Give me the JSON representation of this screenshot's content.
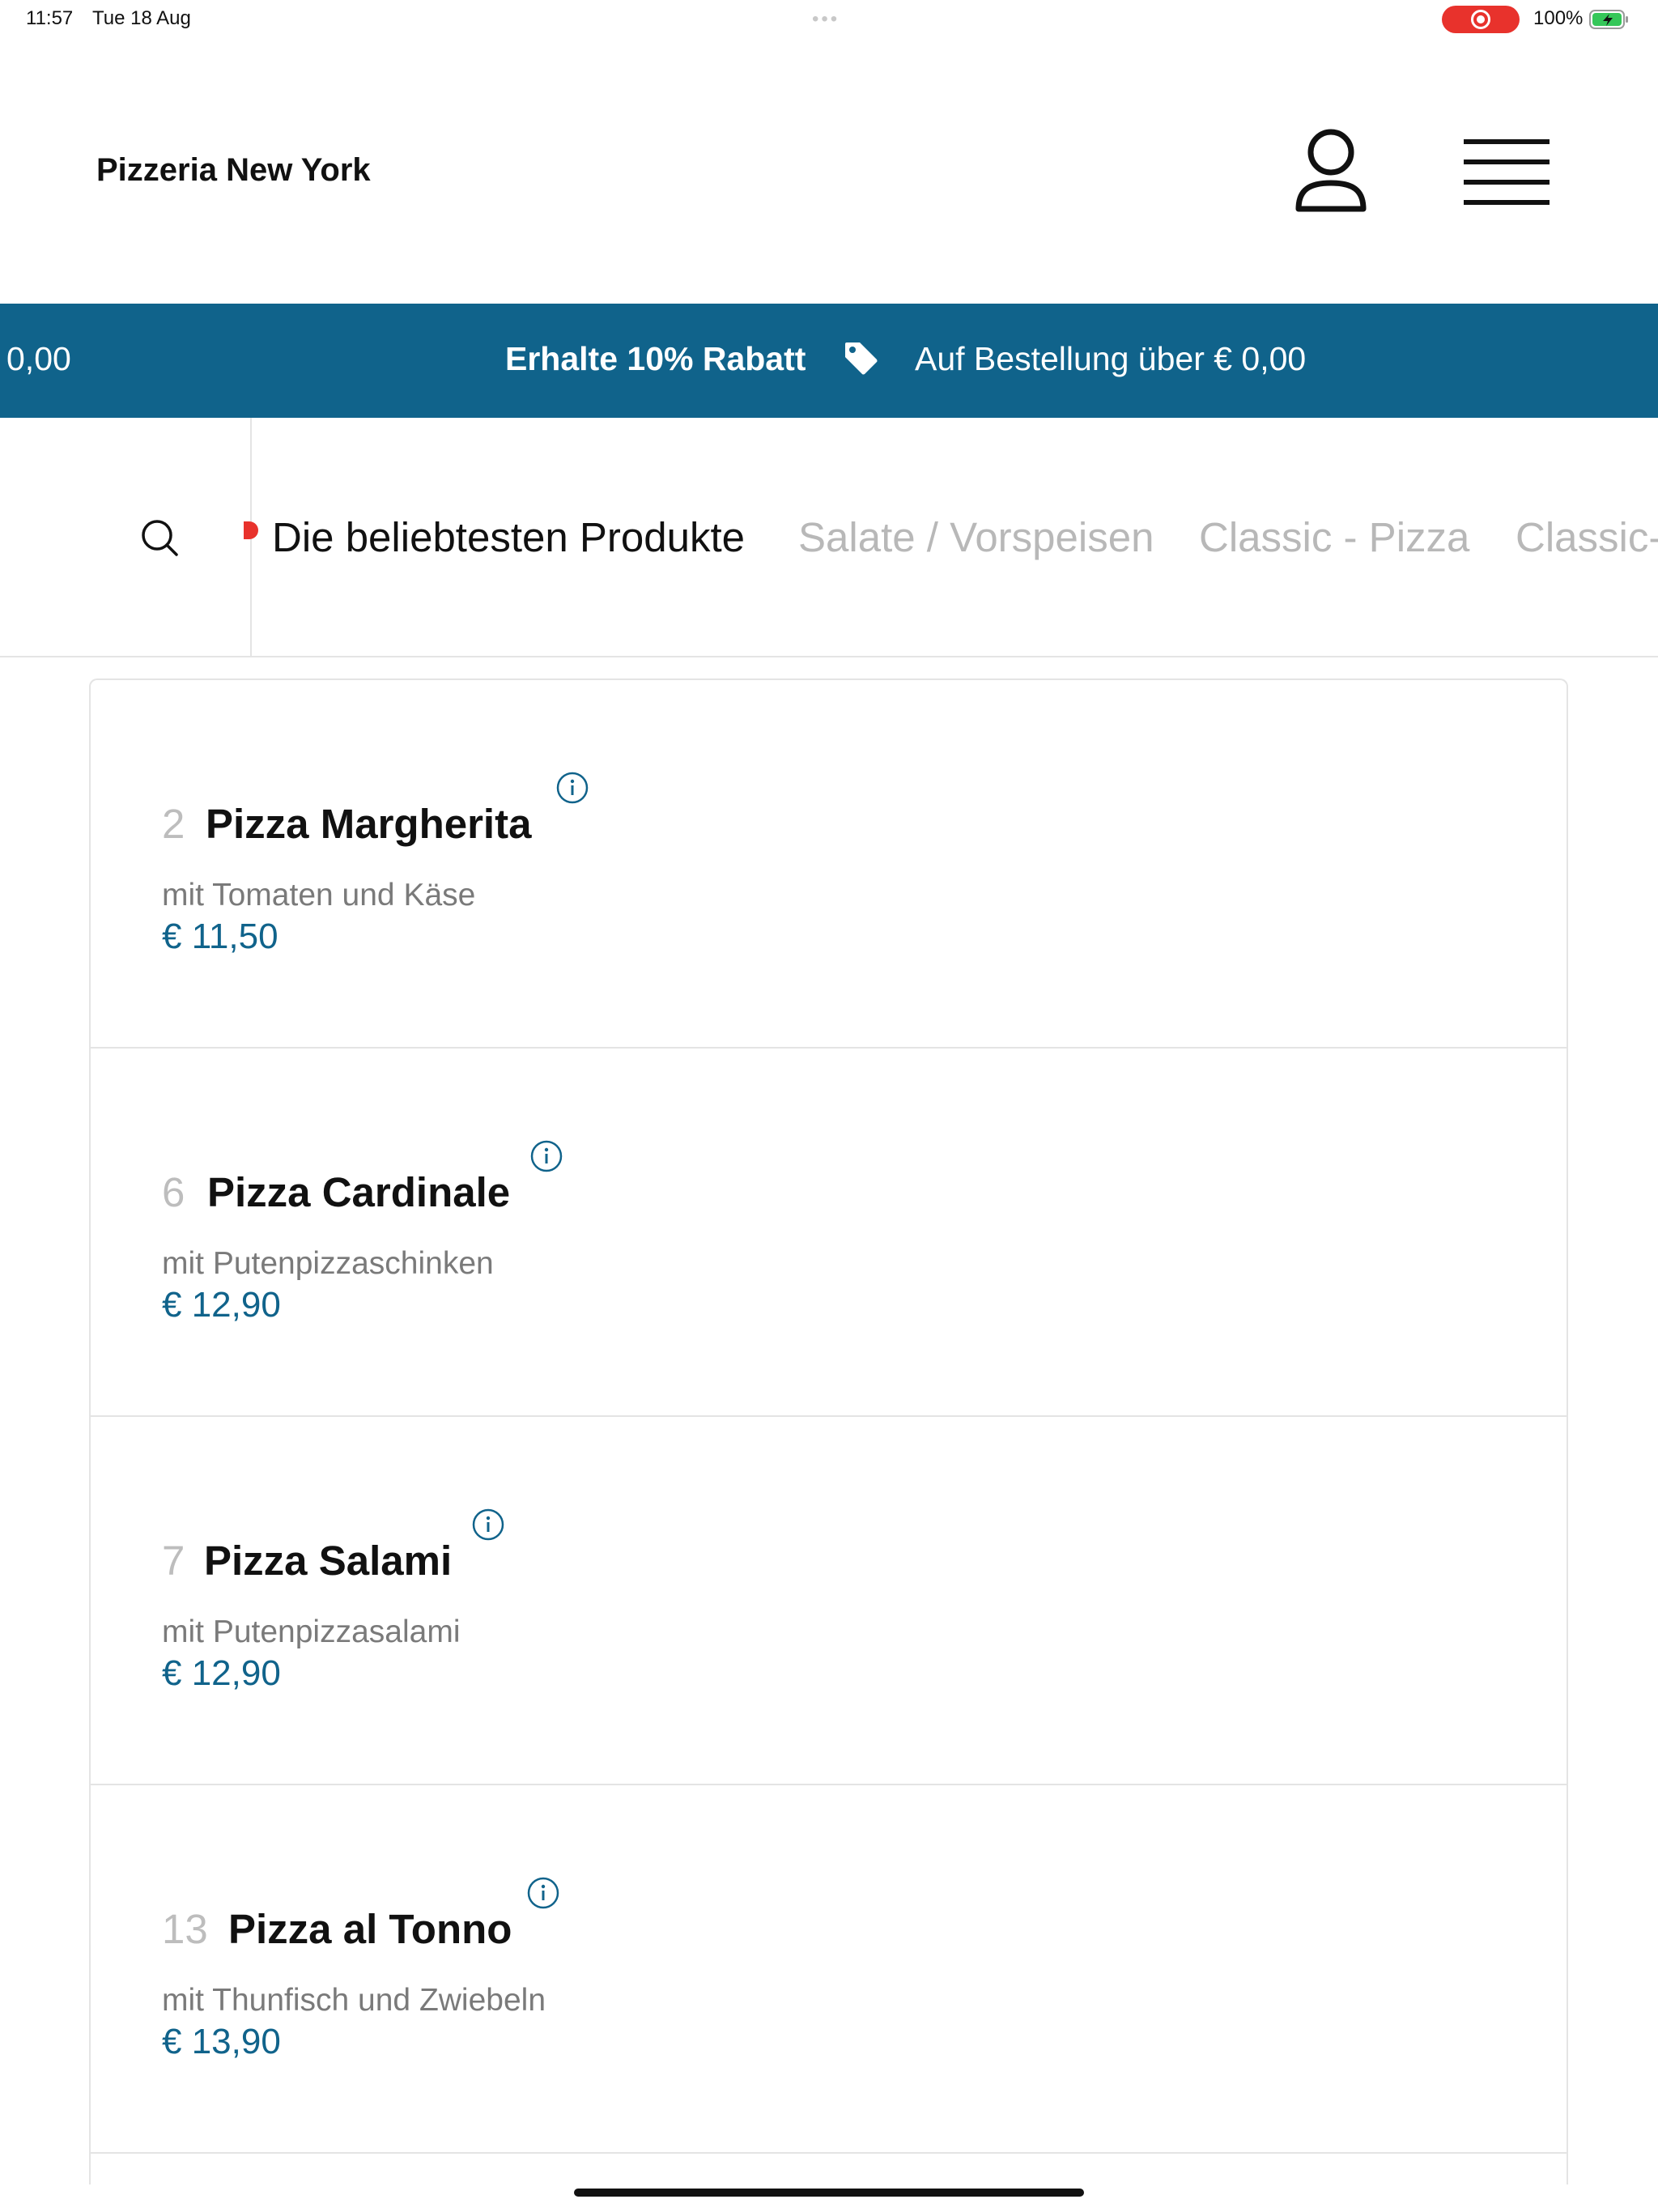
{
  "status_bar": {
    "time": "11:57",
    "date": "Tue 18 Aug",
    "battery": "100%"
  },
  "header": {
    "brand": "Pizzeria New York"
  },
  "promo": {
    "edge_text": "0,00",
    "headline": "Erhalte 10% Rabatt",
    "text": "Auf Bestellung über € 0,00"
  },
  "categories": [
    {
      "label": "Die beliebtesten Produkte",
      "active": true
    },
    {
      "label": "Salate / Vorspeisen",
      "active": false
    },
    {
      "label": "Classic - Pizza",
      "active": false
    },
    {
      "label": "Classic-",
      "active": false
    }
  ],
  "products": [
    {
      "number": "2",
      "name": "Pizza Margherita",
      "description": "mit Tomaten und Käse",
      "price": "€ 11,50"
    },
    {
      "number": "6",
      "name": "Pizza Cardinale",
      "description": "mit Putenpizzaschinken",
      "price": "€ 12,90"
    },
    {
      "number": "7",
      "name": "Pizza Salami",
      "description": "mit Putenpizzasalami",
      "price": "€ 12,90"
    },
    {
      "number": "13",
      "name": "Pizza al Tonno",
      "description": "mit Thunfisch und Zwiebeln",
      "price": "€ 13,90"
    }
  ],
  "colors": {
    "brand_blue": "#10638b",
    "record_red": "#e8322c"
  },
  "icons": {
    "account": "user-icon",
    "menu": "hamburger-menu-icon",
    "search": "search-icon",
    "promo": "price-tag-icon",
    "info": "info-icon"
  }
}
